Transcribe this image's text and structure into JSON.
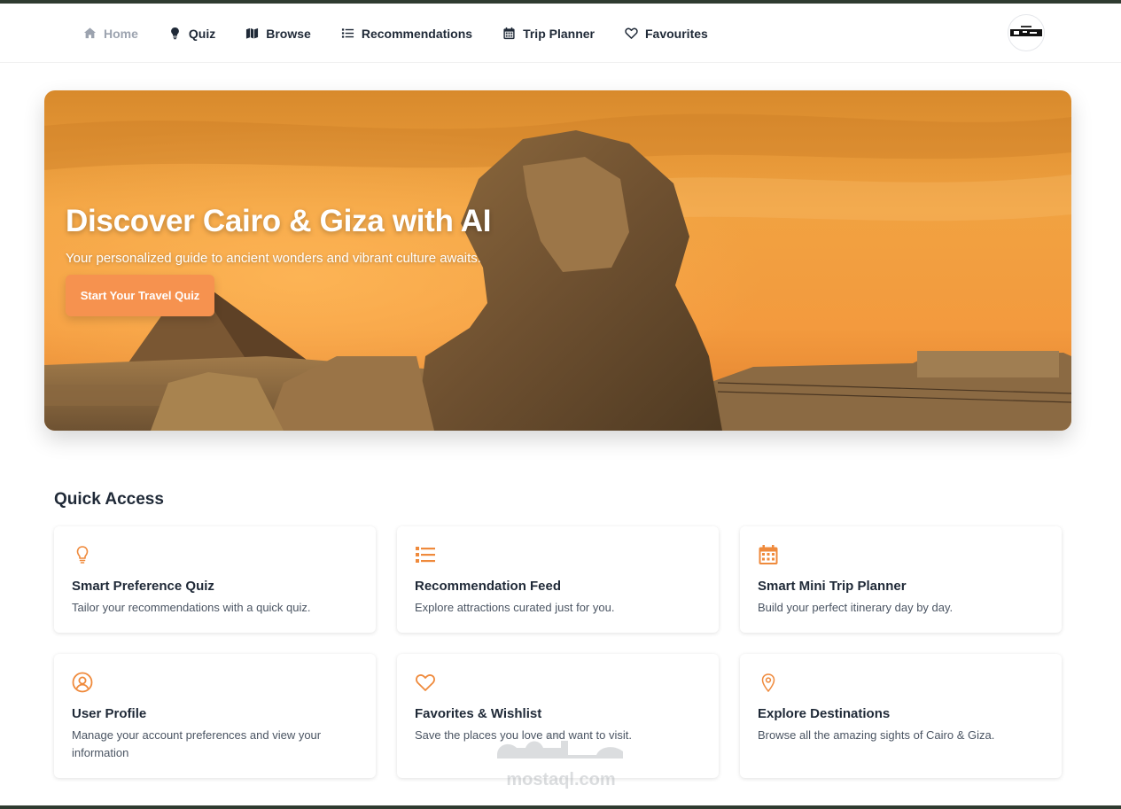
{
  "nav": {
    "items": [
      {
        "label": "Home",
        "icon": "home-icon",
        "active": true
      },
      {
        "label": "Quiz",
        "icon": "lightbulb-icon"
      },
      {
        "label": "Browse",
        "icon": "map-icon"
      },
      {
        "label": "Recommendations",
        "icon": "list-icon"
      },
      {
        "label": "Trip Planner",
        "icon": "calendar-icon"
      },
      {
        "label": "Favourites",
        "icon": "heart-icon"
      }
    ]
  },
  "hero": {
    "title": "Discover Cairo & Giza with AI",
    "subtitle": "Your personalized guide to ancient wonders and vibrant culture awaits.",
    "cta_label": "Start Your Travel Quiz"
  },
  "quick_access": {
    "heading": "Quick Access",
    "cards": [
      {
        "title": "Smart Preference Quiz",
        "description": "Tailor your recommendations with a quick quiz.",
        "icon": "lightbulb-icon"
      },
      {
        "title": "Recommendation Feed",
        "description": "Explore attractions curated just for you.",
        "icon": "list-icon"
      },
      {
        "title": "Smart Mini Trip Planner",
        "description": "Build your perfect itinerary day by day.",
        "icon": "calendar-icon"
      },
      {
        "title": "User Profile",
        "description": "Manage your account preferences and view your information",
        "icon": "user-circle-icon"
      },
      {
        "title": "Favorites & Wishlist",
        "description": "Save the places you love and want to visit.",
        "icon": "heart-icon"
      },
      {
        "title": "Explore Destinations",
        "description": "Browse all the amazing sights of Cairo & Giza.",
        "icon": "map-pin-icon"
      }
    ]
  },
  "watermark": {
    "text": "mostaql.com"
  },
  "colors": {
    "accent": "#f6924f",
    "icon_orange": "#ef8a3c",
    "text_dark": "#1f2937",
    "text_muted": "#4b5563",
    "nav_active": "#9ca3af"
  }
}
